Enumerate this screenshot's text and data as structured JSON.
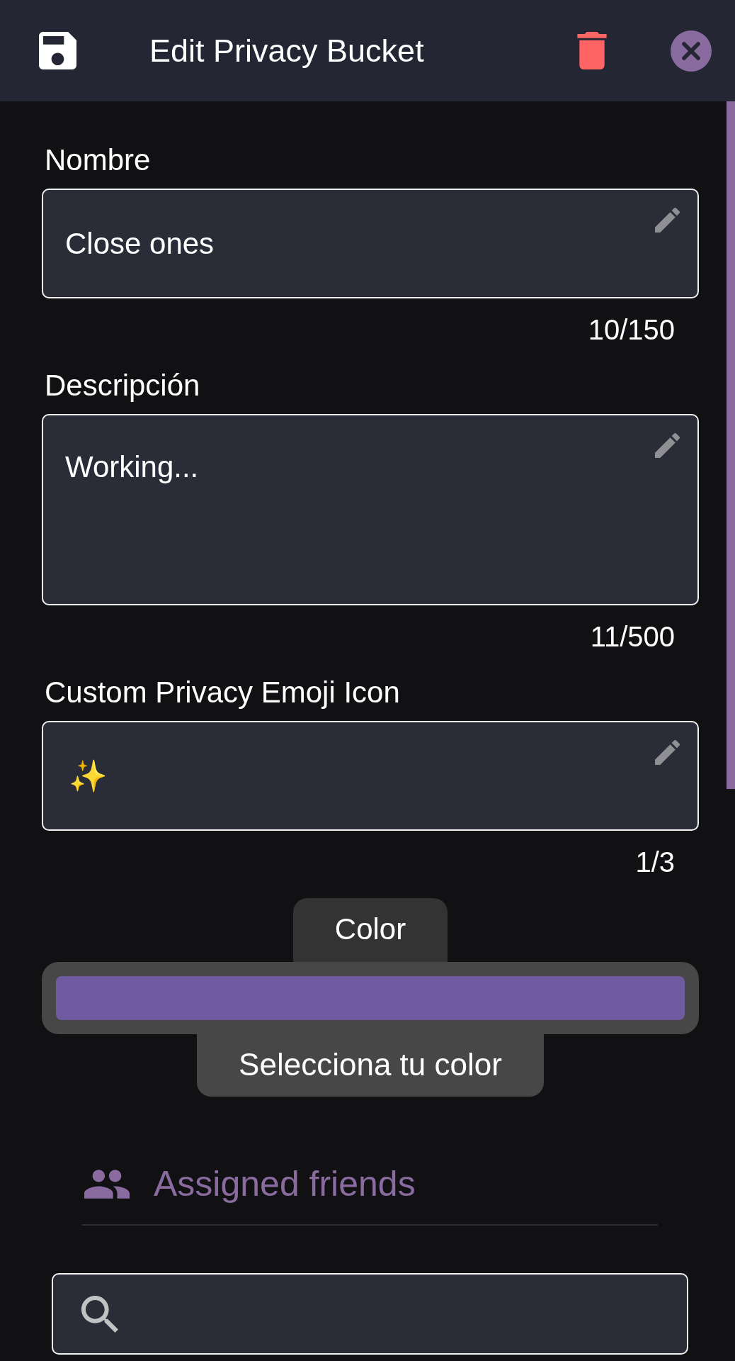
{
  "header": {
    "title": "Edit Privacy Bucket"
  },
  "fields": [
    {
      "kind": "text",
      "label": "Nombre",
      "value": "Close ones",
      "counter": "10/150"
    },
    {
      "kind": "textarea",
      "label": "Descripción",
      "value": "Working...",
      "counter": "11/500"
    },
    {
      "kind": "emoji",
      "label": "Custom Privacy Emoji Icon",
      "value": "✨",
      "counter": "1/3"
    }
  ],
  "color_picker": {
    "label": "Color",
    "color": "#715ba0",
    "button": "Selecciona tu color"
  },
  "friends": {
    "title": "Assigned friends"
  }
}
